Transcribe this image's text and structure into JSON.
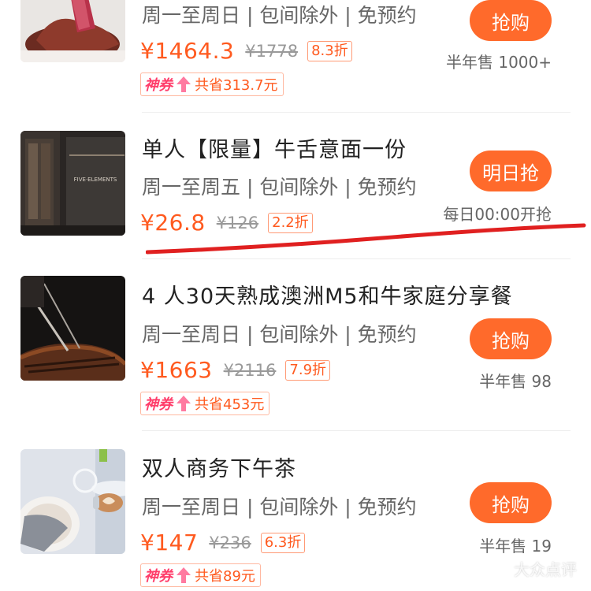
{
  "colors": {
    "accent": "#ff6a2b",
    "price": "#ff5a1f",
    "coupon_tag": "#ff3d6a",
    "annotation": "#e02020"
  },
  "deals": [
    {
      "title": "",
      "terms": "周一至周日 | 包间除外 | 免预约",
      "price": "¥1464.3",
      "original_price": "¥1778",
      "discount": "8.3折",
      "button": "抢购",
      "sold": "半年售 1000+",
      "coupon": {
        "tag": "神券",
        "saving": "共省313.7元"
      },
      "image_icon": "steak-photo"
    },
    {
      "title": "单人【限量】牛舌意面一份",
      "terms": "周一至周五 | 包间除外 | 免预约",
      "price": "¥26.8",
      "original_price": "¥126",
      "discount": "2.2折",
      "button": "明日抢",
      "sold": "每日00:00开抢",
      "image_icon": "restaurant-entrance-photo",
      "image_sign": "FIVE·ELEMENTS"
    },
    {
      "title": "4 人30天熟成澳洲M5和牛家庭分享餐",
      "terms": "周一至周日 | 包间除外 | 免预约",
      "price": "¥1663",
      "original_price": "¥2116",
      "discount": "7.9折",
      "button": "抢购",
      "sold": "半年售 98",
      "coupon": {
        "tag": "神券",
        "saving": "共省453元"
      },
      "image_icon": "grilled-steak-photo"
    },
    {
      "title": "双人商务下午茶",
      "terms": "周一至周日 | 包间除外 | 免预约",
      "price": "¥147",
      "original_price": "¥236",
      "discount": "6.3折",
      "button": "抢购",
      "sold": "半年售 19",
      "coupon": {
        "tag": "神券",
        "saving": "共省89元"
      },
      "image_icon": "coffee-latte-photo"
    }
  ],
  "watermark": "大众点评"
}
